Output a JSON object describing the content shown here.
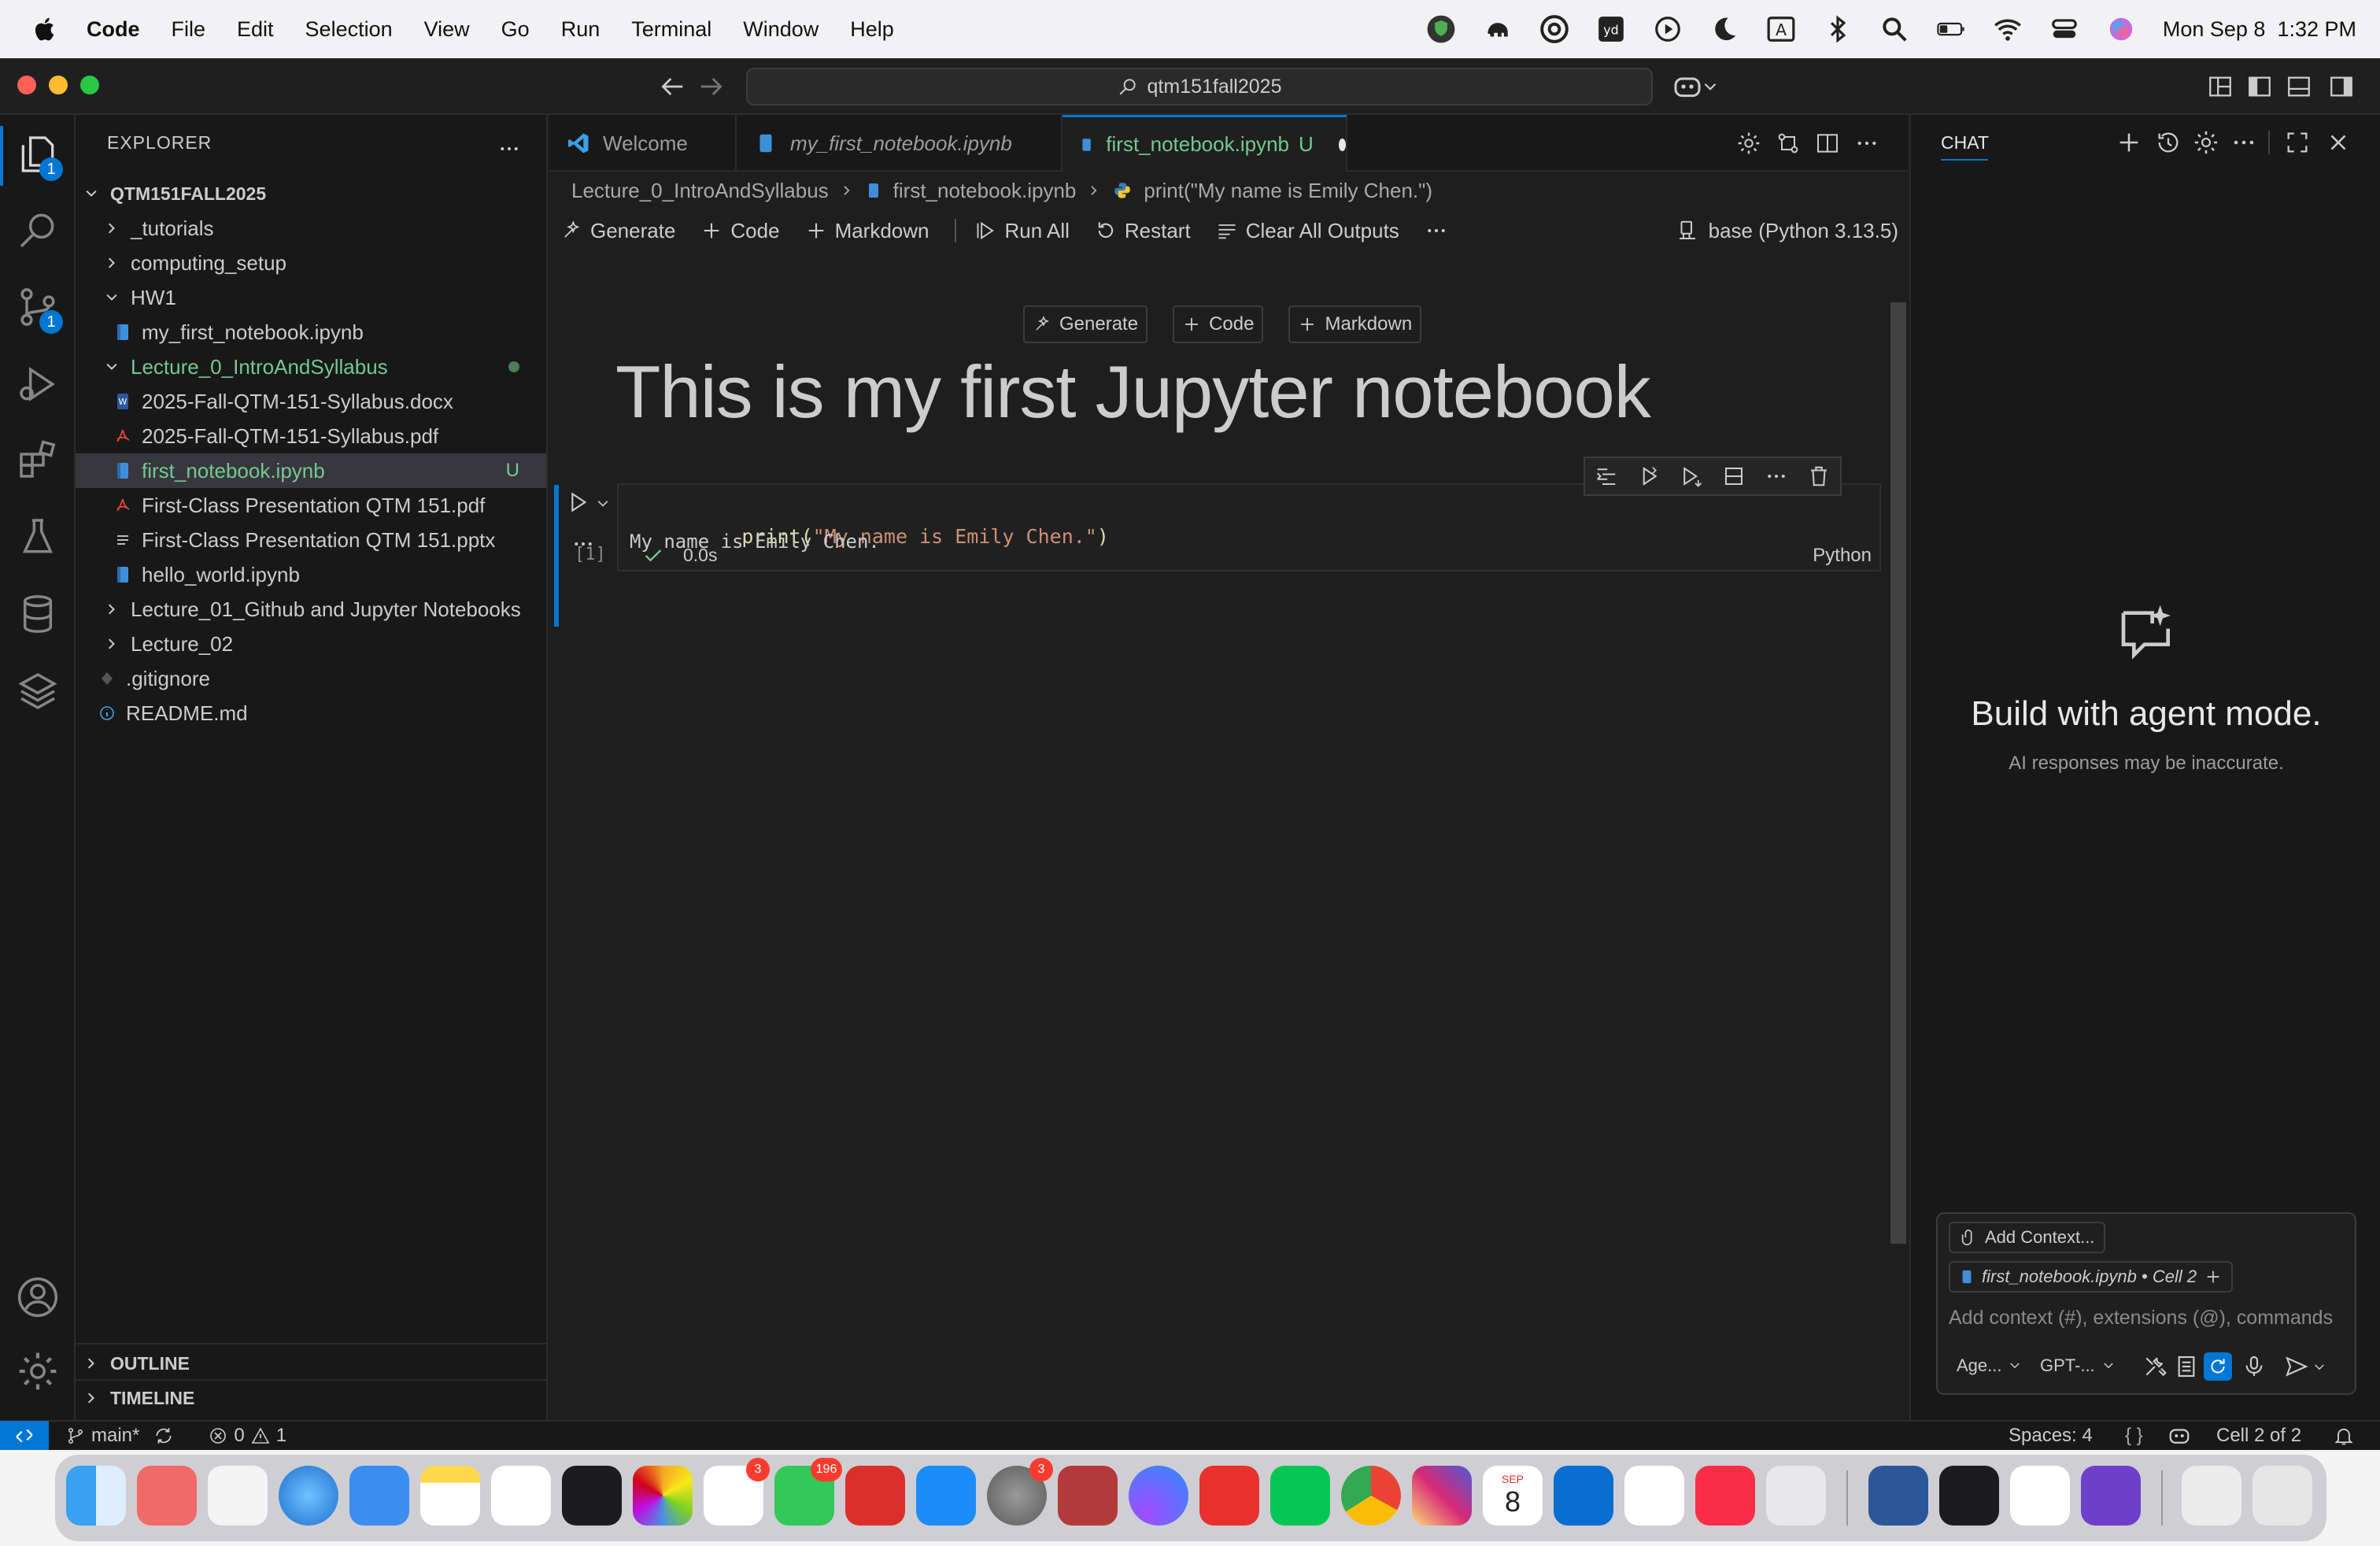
{
  "menubar": {
    "app_name": "Code",
    "items": [
      "File",
      "Edit",
      "Selection",
      "View",
      "Go",
      "Run",
      "Terminal",
      "Window",
      "Help"
    ],
    "clock": "Mon Sep 8  1:32 PM"
  },
  "titlebar": {
    "search_text": "qtm151fall2025"
  },
  "activity": {
    "explorer_badge": "1",
    "scm_badge": "1"
  },
  "explorer": {
    "title": "EXPLORER",
    "root": "QTM151FALL2025",
    "rows": [
      {
        "label": "_tutorials"
      },
      {
        "label": "computing_setup"
      },
      {
        "label": "HW1"
      },
      {
        "label": "my_first_notebook.ipynb"
      },
      {
        "label": "Lecture_0_IntroAndSyllabus"
      },
      {
        "label": "2025-Fall-QTM-151-Syllabus.docx"
      },
      {
        "label": "2025-Fall-QTM-151-Syllabus.pdf"
      },
      {
        "label": "first_notebook.ipynb",
        "status": "U"
      },
      {
        "label": "First-Class Presentation QTM 151.pdf"
      },
      {
        "label": "First-Class Presentation QTM 151.pptx"
      },
      {
        "label": "hello_world.ipynb"
      },
      {
        "label": "Lecture_01_Github and Jupyter Notebooks"
      },
      {
        "label": "Lecture_02"
      },
      {
        "label": ".gitignore"
      },
      {
        "label": "README.md"
      }
    ],
    "outline": "OUTLINE",
    "timeline": "TIMELINE"
  },
  "tabs": [
    {
      "label": "Welcome"
    },
    {
      "label": "my_first_notebook.ipynb"
    },
    {
      "label": "first_notebook.ipynb",
      "status": "U"
    }
  ],
  "breadcrumb": [
    "Lecture_0_IntroAndSyllabus",
    "first_notebook.ipynb",
    "print(\"My name is Emily Chen.\")"
  ],
  "toolbar": {
    "generate": "Generate",
    "code": "Code",
    "markdown": "Markdown",
    "run_all": "Run All",
    "restart": "Restart",
    "clear": "Clear All Outputs",
    "kernel": "base (Python 3.13.5)"
  },
  "inline": {
    "generate": "Generate",
    "code": "Code",
    "markdown": "Markdown"
  },
  "notebook": {
    "heading": "This is my first Jupyter notebook",
    "cell_code_fn": "print(",
    "cell_code_str": "\"My name is Emily Chen.\"",
    "cell_code_end": ")",
    "exec_count": "[1]",
    "duration": "0.0s",
    "language": "Python",
    "output": "My name is Emily Chen."
  },
  "chat": {
    "title": "CHAT",
    "heading": "Build with agent mode.",
    "subtext": "AI responses may be inaccurate.",
    "add_context": "Add Context...",
    "file_chip": "first_notebook.ipynb • Cell 2",
    "placeholder": "Add context (#), extensions (@), commands",
    "mode": "Age...",
    "model": "GPT-..."
  },
  "statusbar": {
    "branch": "main*",
    "errors": "0",
    "warnings": "1",
    "spaces": "Spaces: 4",
    "cell": "Cell 2 of 2"
  },
  "dock": {
    "reminders_badge": "3",
    "messages_badge": "196",
    "settings_badge": "3",
    "calendar_month": "SEP",
    "calendar_day": "8"
  }
}
